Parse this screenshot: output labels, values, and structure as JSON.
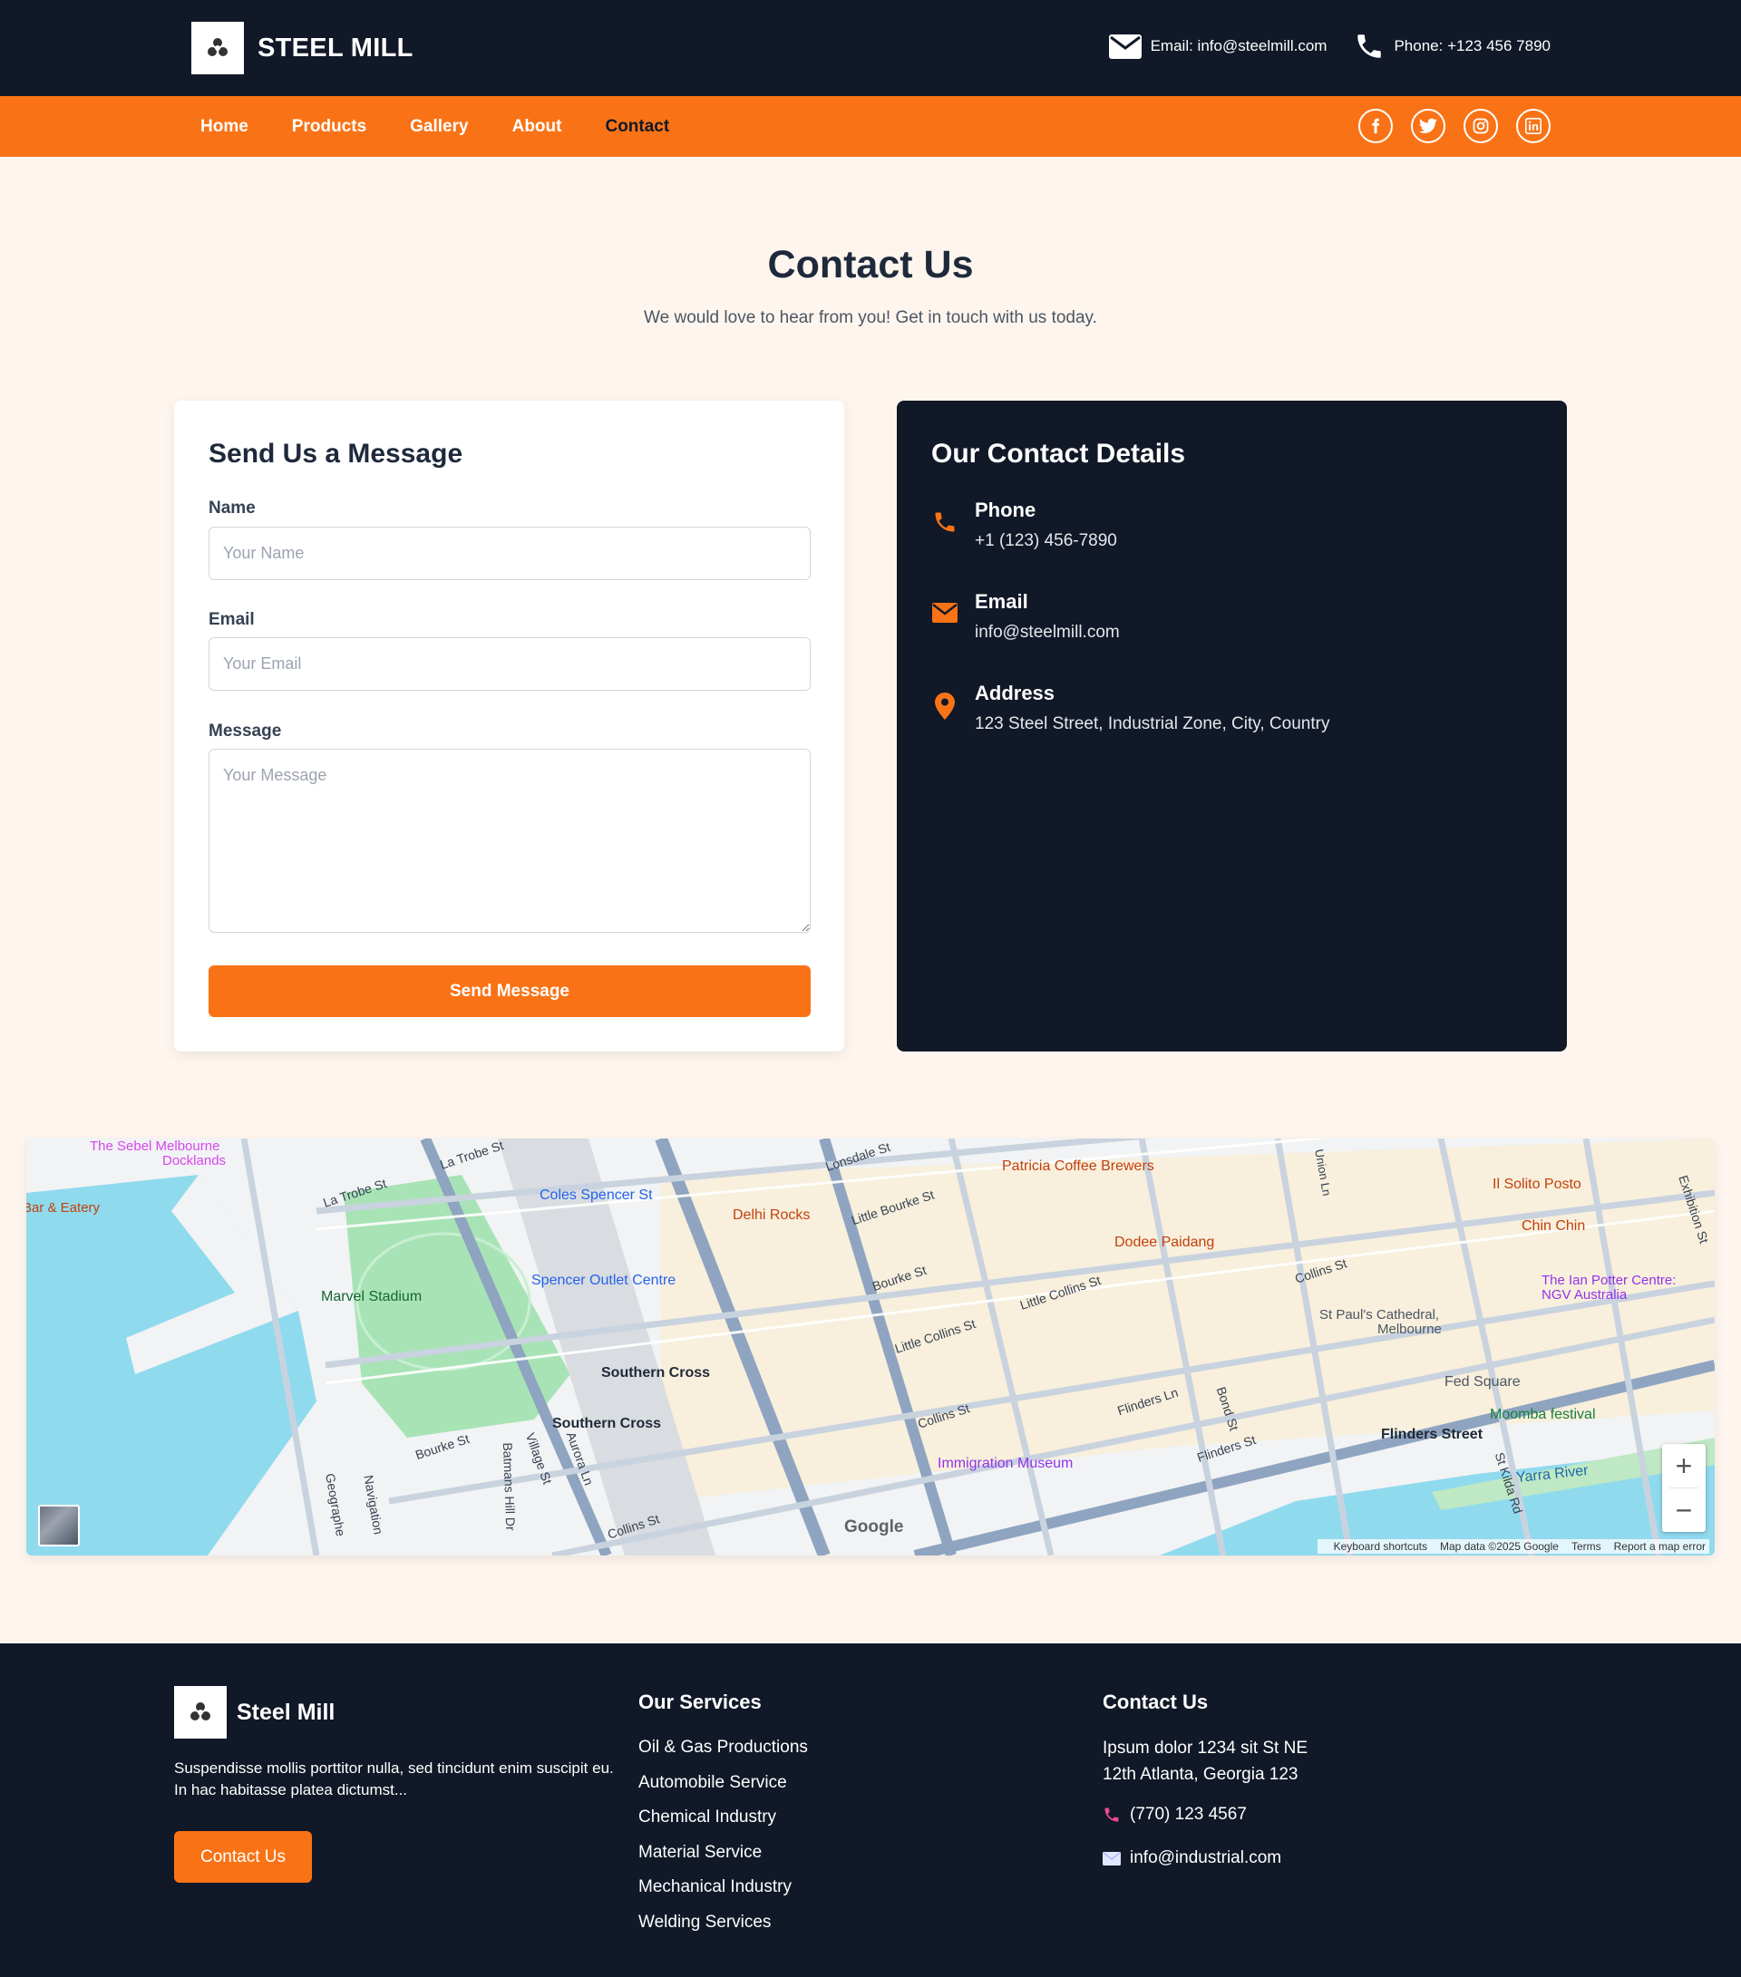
{
  "header": {
    "brand": "STEEL MILL",
    "email": "Email: info@steelmill.com",
    "phone": "Phone: +123 456 7890"
  },
  "nav": {
    "items": [
      {
        "label": "Home",
        "active": false
      },
      {
        "label": "Products",
        "active": false
      },
      {
        "label": "Gallery",
        "active": false
      },
      {
        "label": "About",
        "active": false
      },
      {
        "label": "Contact",
        "active": true
      }
    ],
    "socials": [
      "facebook-icon",
      "twitter-icon",
      "instagram-icon",
      "linkedin-icon"
    ]
  },
  "hero": {
    "title": "Contact Us",
    "subtitle": "We would love to hear from you! Get in touch with us today."
  },
  "form": {
    "title": "Send Us a Message",
    "name_label": "Name",
    "name_placeholder": "Your Name",
    "email_label": "Email",
    "email_placeholder": "Your Email",
    "message_label": "Message",
    "message_placeholder": "Your Message",
    "submit": "Send Message"
  },
  "details": {
    "title": "Our Contact Details",
    "phone_label": "Phone",
    "phone_value": "+1 (123) 456-7890",
    "email_label": "Email",
    "email_value": "info@steelmill.com",
    "address_label": "Address",
    "address_value": "123 Steel Street, Industrial Zone, City, Country"
  },
  "map": {
    "labels": {
      "sebel": "The Sebel Melbourne",
      "docklands": "Docklands",
      "bar_eatery": "Bar & Eatery",
      "marvel": "Marvel Stadium",
      "coles": "Coles Spencer St",
      "spencer_outlet": "Spencer Outlet Centre",
      "southern_cross_1": "Southern Cross",
      "southern_cross_2": "Southern Cross",
      "delhi": "Delhi Rocks",
      "patricia": "Patricia Coffee Brewers",
      "dodee": "Dodee Paidang",
      "il_solito": "Il Solito Posto",
      "chin_chin": "Chin Chin",
      "ian_potter_1": "The Ian Potter Centre:",
      "ian_potter_2": "NGV Australia",
      "st_pauls_1": "St Paul's Cathedral,",
      "st_pauls_2": "Melbourne",
      "fed_square": "Fed Square",
      "moomba": "Moomba festival",
      "flinders_street": "Flinders Street",
      "yarra": "Yarra River",
      "immigration": "Immigration Museum",
      "la_trobe_1": "La Trobe St",
      "la_trobe_2": "La Trobe St",
      "lonsdale": "Lonsdale St",
      "little_bourke": "Little Bourke St",
      "bourke_1": "Bourke St",
      "bourke_2": "Bourke St",
      "little_collins_1": "Little Collins St",
      "little_collins_2": "Little Collins St",
      "collins_1": "Collins St",
      "collins_2": "Collins St",
      "collins_3": "Collins St",
      "flinders_ln": "Flinders Ln",
      "flinders_st": "Flinders St",
      "bond": "Bond St",
      "st_kilda": "St Kilda Rd",
      "exhibition": "Exhibition St",
      "union": "Union Ln",
      "village": "Village St",
      "aurora": "Aurora Ln",
      "batmans": "Batmans Hill Dr",
      "geographe": "Geographe",
      "navigation": "Navigation"
    },
    "zoom_in": "+",
    "zoom_out": "−",
    "google": "Google",
    "footer_shortcuts": "Keyboard shortcuts",
    "footer_data": "Map data ©2025 Google",
    "footer_terms": "Terms",
    "footer_report": "Report a map error"
  },
  "footer": {
    "brand": "Steel Mill",
    "description": "Suspendisse mollis porttitor nulla, sed tincidunt enim suscipit eu. In hac habitasse platea dictumst...",
    "button": "Contact Us",
    "services_title": "Our Services",
    "services": [
      "Oil & Gas Productions",
      "Automobile Service",
      "Chemical Industry",
      "Material Service",
      "Mechanical Industry",
      "Welding Services"
    ],
    "contact_title": "Contact Us",
    "address_line1": "Ipsum dolor 1234 sit St NE",
    "address_line2": "12th Atlanta, Georgia 123",
    "phone": "(770) 123 4567",
    "email": "info@industrial.com"
  },
  "colors": {
    "dark": "#111827",
    "accent": "#f97316",
    "page_bg": "#fef6ee"
  }
}
